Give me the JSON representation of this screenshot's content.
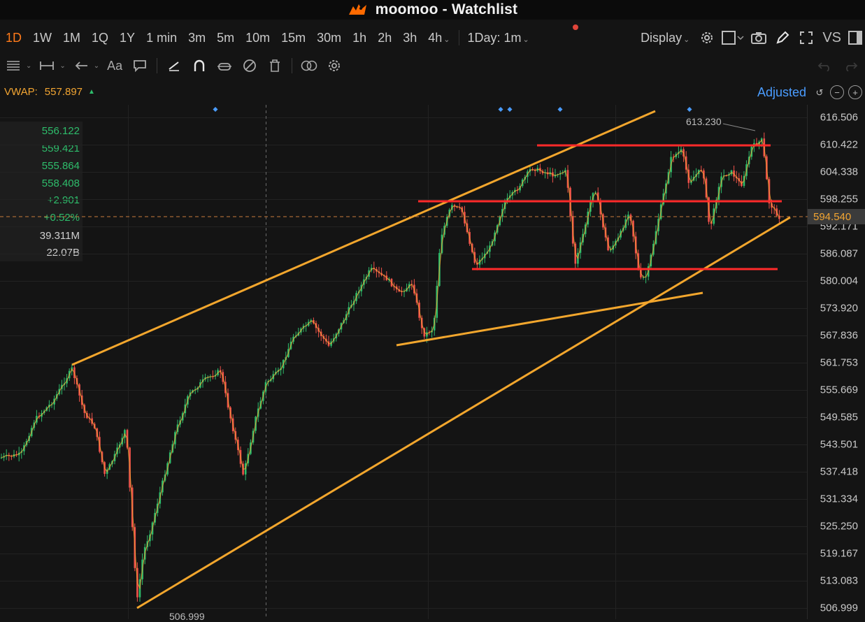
{
  "window": {
    "title": "moomoo - Watchlist"
  },
  "toolbar": {
    "timeframes": [
      "1D",
      "1W",
      "1M",
      "1Q",
      "1Y",
      "1 min",
      "3m",
      "5m",
      "10m",
      "15m",
      "30m",
      "1h",
      "2h",
      "3h"
    ],
    "active_timeframe": "1D",
    "more_timeframe": "4h",
    "overlay_label": "1Day: 1m",
    "display_label": "Display",
    "vs_label": "VS"
  },
  "indicator": {
    "name": "VWAP:",
    "value": "557.897",
    "direction": "up"
  },
  "adjusted_label": "Adjusted",
  "info_panel": {
    "open": "556.122",
    "high": "559.421",
    "low": "555.864",
    "close": "558.408",
    "change": "+2.901",
    "change_pct": "+0.52%",
    "volume": "39.311M",
    "turnover": "22.07B"
  },
  "price_axis": [
    "616.506",
    "610.422",
    "604.338",
    "598.255",
    "592.171",
    "586.087",
    "580.004",
    "573.920",
    "567.836",
    "561.753",
    "555.669",
    "549.585",
    "543.501",
    "537.418",
    "531.334",
    "525.250",
    "519.167",
    "513.083",
    "506.999"
  ],
  "current_price": "594.540",
  "high_marker": "613.230",
  "low_marker": "506.999",
  "colors": {
    "up": "#2ebd6b",
    "down": "#f0524a",
    "accent": "#ff7a1a",
    "trendline": "#f2a62d",
    "level": "#ff2a2a",
    "link": "#4a9cff"
  }
}
